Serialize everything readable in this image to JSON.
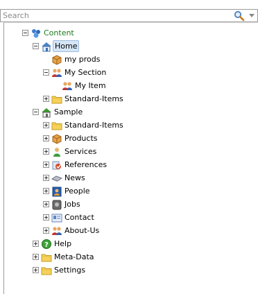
{
  "search": {
    "placeholder": "Search"
  },
  "tree": [
    {
      "label": "Content",
      "icon": "content-icon",
      "level": 0,
      "expander": "minus",
      "green": true
    },
    {
      "label": "Home",
      "icon": "home-icon",
      "level": 1,
      "expander": "minus",
      "selected": true
    },
    {
      "label": "my prods",
      "icon": "product-box-icon",
      "level": 2,
      "expander": "none"
    },
    {
      "label": "My Section",
      "icon": "people-icon",
      "level": 2,
      "expander": "minus"
    },
    {
      "label": "My Item",
      "icon": "people-icon",
      "level": 3,
      "expander": "none"
    },
    {
      "label": "Standard-Items",
      "icon": "folder-icon",
      "level": 2,
      "expander": "plus"
    },
    {
      "label": "Sample",
      "icon": "home-green-icon",
      "level": 1,
      "expander": "minus"
    },
    {
      "label": "Standard-Items",
      "icon": "folder-icon",
      "level": 2,
      "expander": "plus"
    },
    {
      "label": "Products",
      "icon": "product-box-icon",
      "level": 2,
      "expander": "plus"
    },
    {
      "label": "Services",
      "icon": "service-person-icon",
      "level": 2,
      "expander": "plus"
    },
    {
      "label": "References",
      "icon": "reference-icon",
      "level": 2,
      "expander": "plus"
    },
    {
      "label": "News",
      "icon": "news-icon",
      "level": 2,
      "expander": "plus"
    },
    {
      "label": "People",
      "icon": "person-card-icon",
      "level": 2,
      "expander": "plus"
    },
    {
      "label": "Jobs",
      "icon": "jobs-icon",
      "level": 2,
      "expander": "plus"
    },
    {
      "label": "Contact",
      "icon": "contact-card-icon",
      "level": 2,
      "expander": "plus"
    },
    {
      "label": "About-Us",
      "icon": "people-icon",
      "level": 2,
      "expander": "plus"
    },
    {
      "label": "Help",
      "icon": "help-icon",
      "level": 1,
      "expander": "plus"
    },
    {
      "label": "Meta-Data",
      "icon": "folder-icon",
      "level": 1,
      "expander": "plus"
    },
    {
      "label": "Settings",
      "icon": "folder-icon",
      "level": 1,
      "expander": "plus"
    }
  ]
}
